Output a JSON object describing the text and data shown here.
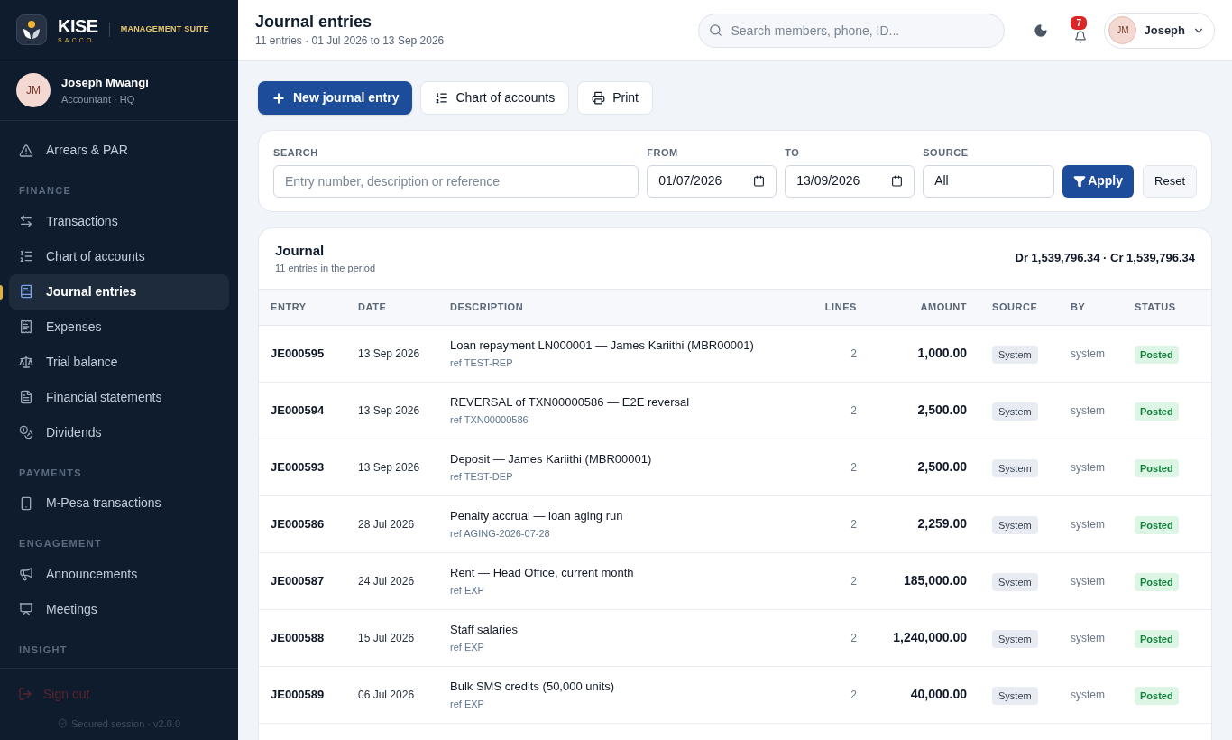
{
  "brand": {
    "name": "KISE",
    "sub": "SACCO",
    "suite": "MANAGEMENT SUITE"
  },
  "user": {
    "initials": "JM",
    "name": "Joseph Mwangi",
    "role": "Accountant · HQ"
  },
  "sidebar": [
    {
      "kind": "item",
      "label": "Arrears & PAR",
      "selected": false
    },
    {
      "kind": "section",
      "label": "FINANCE"
    },
    {
      "kind": "item",
      "label": "Transactions",
      "selected": false
    },
    {
      "kind": "item",
      "label": "Chart of accounts",
      "selected": false
    },
    {
      "kind": "item",
      "label": "Journal entries",
      "selected": true
    },
    {
      "kind": "item",
      "label": "Expenses",
      "selected": false
    },
    {
      "kind": "item",
      "label": "Trial balance",
      "selected": false
    },
    {
      "kind": "item",
      "label": "Financial statements",
      "selected": false
    },
    {
      "kind": "item",
      "label": "Dividends",
      "selected": false
    },
    {
      "kind": "section",
      "label": "PAYMENTS"
    },
    {
      "kind": "item",
      "label": "M-Pesa transactions",
      "selected": false
    },
    {
      "kind": "section",
      "label": "ENGAGEMENT"
    },
    {
      "kind": "item",
      "label": "Announcements",
      "selected": false
    },
    {
      "kind": "item",
      "label": "Meetings",
      "selected": false
    },
    {
      "kind": "section",
      "label": "INSIGHT"
    }
  ],
  "sign_out": "Sign out",
  "session": "Secured session · v2.0.0",
  "header": {
    "title": "Journal entries",
    "subtitle": "11 entries · 01 Jul 2026 to 13 Sep 2026",
    "search_placeholder": "Search members, phone, ID...",
    "notifications": "7",
    "user_initials": "JM",
    "user_name": "Joseph"
  },
  "actions": [
    {
      "kind": "primary",
      "label": "New journal entry"
    },
    {
      "kind": "list",
      "label": "Chart of accounts"
    },
    {
      "kind": "print",
      "label": "Print"
    }
  ],
  "filters": {
    "search_label": "SEARCH",
    "search_placeholder": "Entry number, description or reference",
    "from_label": "FROM",
    "from": "01/07/2026",
    "to_label": "TO",
    "to": "13/09/2026",
    "source_label": "SOURCE",
    "source": "All",
    "apply": "Apply",
    "reset": "Reset"
  },
  "journal": {
    "title": "Journal",
    "subtitle": "11 entries in the period",
    "totals": "Dr 1,539,796.34 · Cr 1,539,796.34",
    "columns": [
      "ENTRY",
      "DATE",
      "DESCRIPTION",
      "LINES",
      "AMOUNT",
      "SOURCE",
      "BY",
      "STATUS"
    ],
    "rows": [
      {
        "entry": "JE000595",
        "date": "13 Sep 2026",
        "description": "Loan repayment LN000001 — James Kariithi (MBR00001)",
        "ref": "ref TEST-REP",
        "lines": "2",
        "amount": "1,000.00",
        "source": "System",
        "by": "system",
        "status": "Posted"
      },
      {
        "entry": "JE000594",
        "date": "13 Sep 2026",
        "description": "REVERSAL of TXN00000586 — E2E reversal",
        "ref": "ref TXN00000586",
        "lines": "2",
        "amount": "2,500.00",
        "source": "System",
        "by": "system",
        "status": "Posted"
      },
      {
        "entry": "JE000593",
        "date": "13 Sep 2026",
        "description": "Deposit — James Kariithi (MBR00001)",
        "ref": "ref TEST-DEP",
        "lines": "2",
        "amount": "2,500.00",
        "source": "System",
        "by": "system",
        "status": "Posted"
      },
      {
        "entry": "JE000586",
        "date": "28 Jul 2026",
        "description": "Penalty accrual — loan aging run",
        "ref": "ref AGING-2026-07-28",
        "lines": "2",
        "amount": "2,259.00",
        "source": "System",
        "by": "system",
        "status": "Posted"
      },
      {
        "entry": "JE000587",
        "date": "24 Jul 2026",
        "description": "Rent — Head Office, current month",
        "ref": "ref EXP",
        "lines": "2",
        "amount": "185,000.00",
        "source": "System",
        "by": "system",
        "status": "Posted"
      },
      {
        "entry": "JE000588",
        "date": "15 Jul 2026",
        "description": "Staff salaries",
        "ref": "ref EXP",
        "lines": "2",
        "amount": "1,240,000.00",
        "source": "System",
        "by": "system",
        "status": "Posted"
      },
      {
        "entry": "JE000589",
        "date": "06 Jul 2026",
        "description": "Bulk SMS credits (50,000 units)",
        "ref": "ref EXP",
        "lines": "2",
        "amount": "40,000.00",
        "source": "System",
        "by": "system",
        "status": "Posted"
      }
    ]
  }
}
